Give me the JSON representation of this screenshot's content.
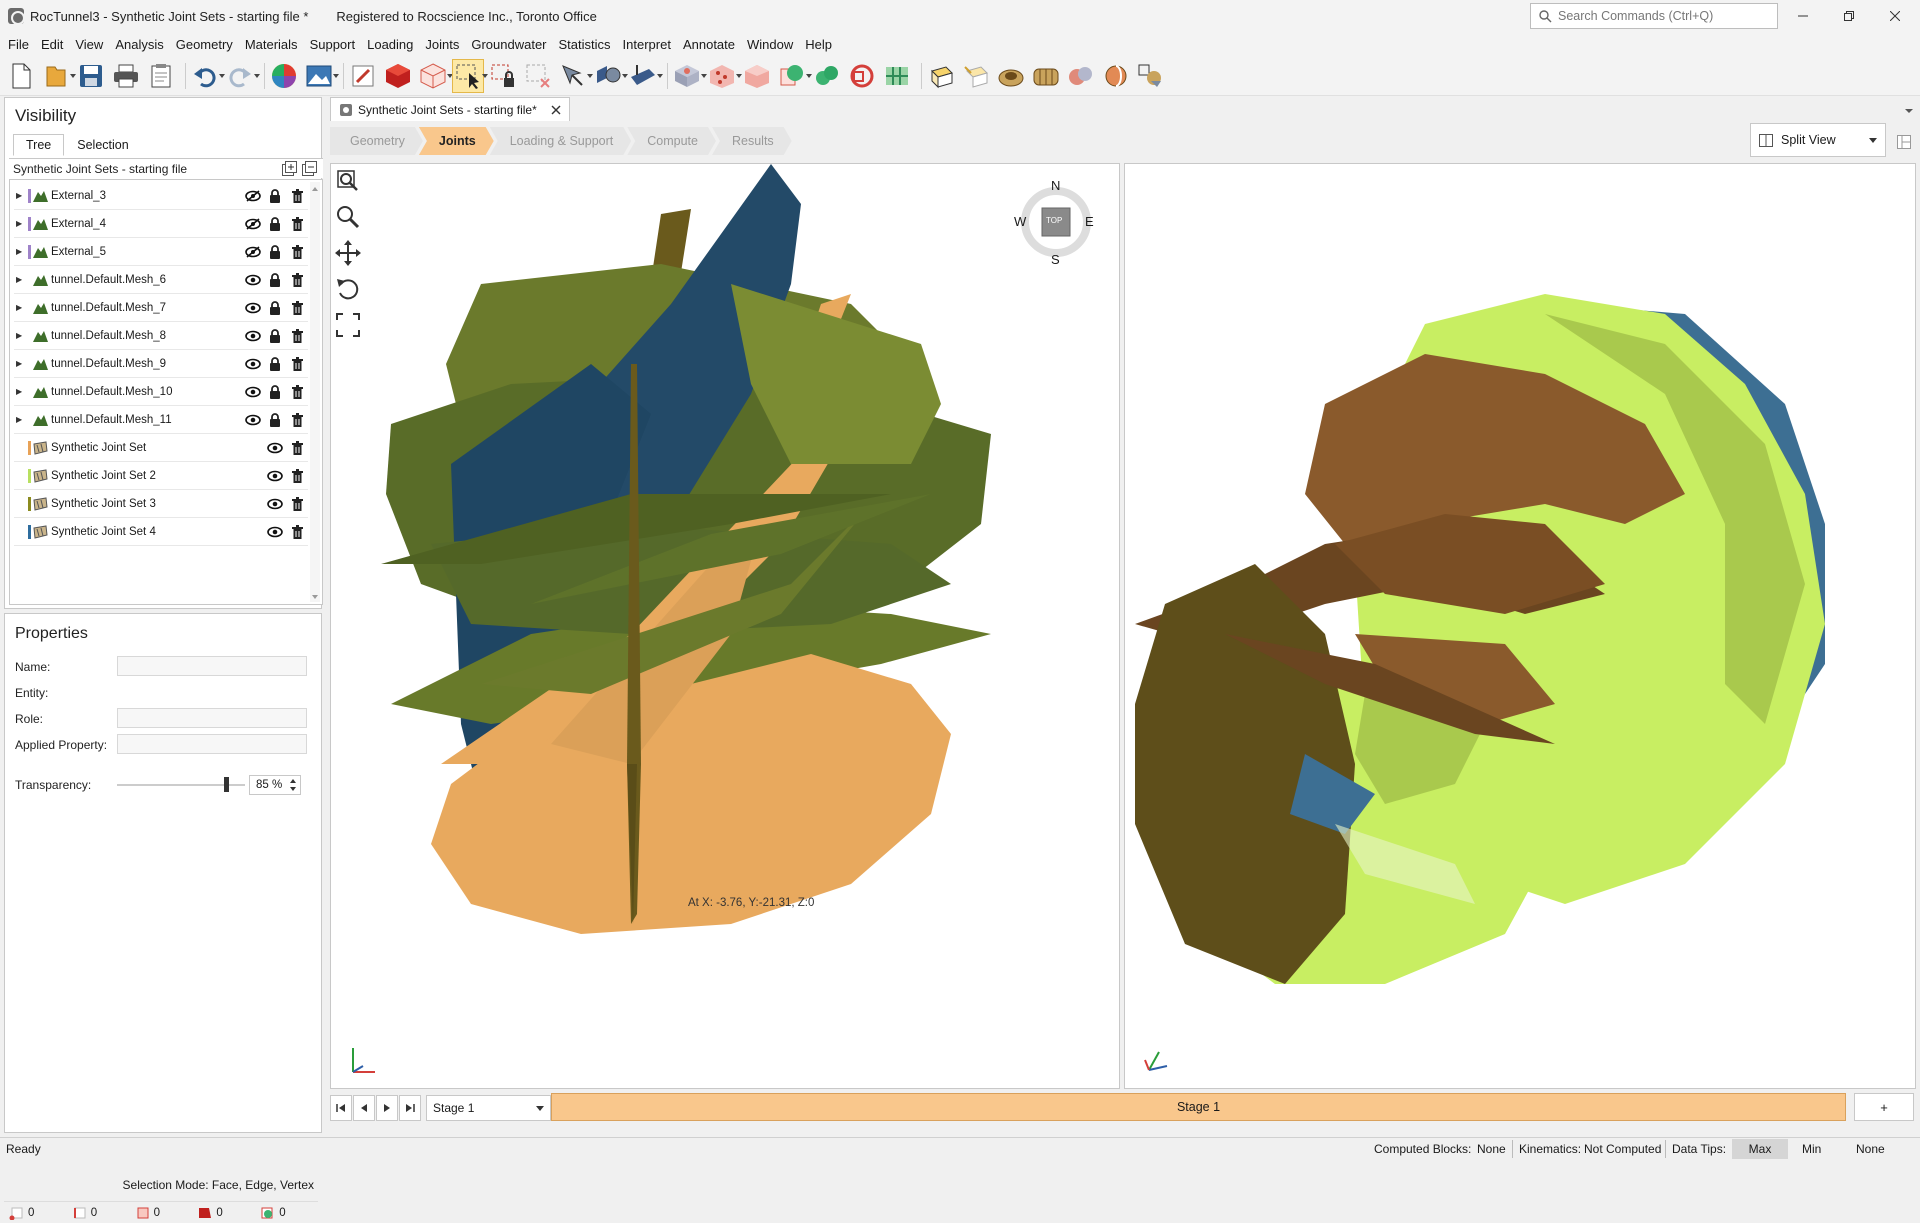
{
  "window": {
    "title": "RocTunnel3 - Synthetic Joint Sets - starting file *",
    "registration": "Registered to Rocscience Inc., Toronto Office",
    "search_placeholder": "Search Commands (Ctrl+Q)"
  },
  "menu": [
    "File",
    "Edit",
    "View",
    "Analysis",
    "Geometry",
    "Materials",
    "Support",
    "Loading",
    "Joints",
    "Groundwater",
    "Statistics",
    "Interpret",
    "Annotate",
    "Window",
    "Help"
  ],
  "visibility": {
    "heading": "Visibility",
    "tabs": [
      "Tree",
      "Selection"
    ],
    "tree_title": "Synthetic Joint Sets - starting file",
    "items": [
      {
        "label": "External_3",
        "visible": false
      },
      {
        "label": "External_4",
        "visible": false
      },
      {
        "label": "External_5",
        "visible": false
      },
      {
        "label": "tunnel.Default.Mesh_6",
        "visible": true
      },
      {
        "label": "tunnel.Default.Mesh_7",
        "visible": true
      },
      {
        "label": "tunnel.Default.Mesh_8",
        "visible": true
      },
      {
        "label": "tunnel.Default.Mesh_9",
        "visible": true
      },
      {
        "label": "tunnel.Default.Mesh_10",
        "visible": true
      },
      {
        "label": "tunnel.Default.Mesh_11",
        "visible": true
      },
      {
        "label": "Synthetic Joint Set",
        "visible": true,
        "color": "#e8a257"
      },
      {
        "label": "Synthetic Joint Set 2",
        "visible": true,
        "color": "#b8e060"
      },
      {
        "label": "Synthetic Joint Set 3",
        "visible": true,
        "color": "#8b8b1f"
      },
      {
        "label": "Synthetic Joint Set 4",
        "visible": true,
        "color": "#2e6d9e"
      }
    ]
  },
  "properties": {
    "heading": "Properties",
    "name_label": "Name:",
    "entity_label": "Entity:",
    "role_label": "Role:",
    "applied_label": "Applied Property:",
    "transparency_label": "Transparency:",
    "transparency_value": "85 %",
    "transparency_fraction": 0.85,
    "selection_mode": "Selection Mode: Face, Edge, Vertex",
    "filter_counts": [
      "0",
      "0",
      "0",
      "0",
      "0"
    ]
  },
  "document": {
    "tab_title": "Synthetic Joint Sets - starting file*",
    "workflow": [
      "Geometry",
      "Joints",
      "Loading & Support",
      "Compute",
      "Results"
    ],
    "active_step": "Joints",
    "split_view_label": "Split View",
    "compass": {
      "n": "N",
      "s": "S",
      "e": "E",
      "w": "W",
      "top": "TOP"
    },
    "coord_readout": "At X: -3.76, Y:-21.31, Z:0",
    "stage_select": "Stage 1",
    "stage_tab": "Stage 1",
    "stage_add": "+"
  },
  "status": {
    "ready": "Ready",
    "computed_blocks_label": "Computed Blocks:",
    "computed_blocks_value": "None",
    "kinematics_label": "Kinematics:",
    "kinematics_value": "Not Computed",
    "data_tips_label": "Data Tips:",
    "data_tips_options": [
      "Max",
      "Min",
      "None"
    ],
    "data_tips_selected": "Max"
  },
  "colors": {
    "olive": "#6b7a2c",
    "navy": "#234a68",
    "tan": "#e8a95e",
    "lime": "#c8ee62",
    "brown": "#8a5a2c",
    "steel": "#3d6f93",
    "accent": "#f9c78c"
  }
}
